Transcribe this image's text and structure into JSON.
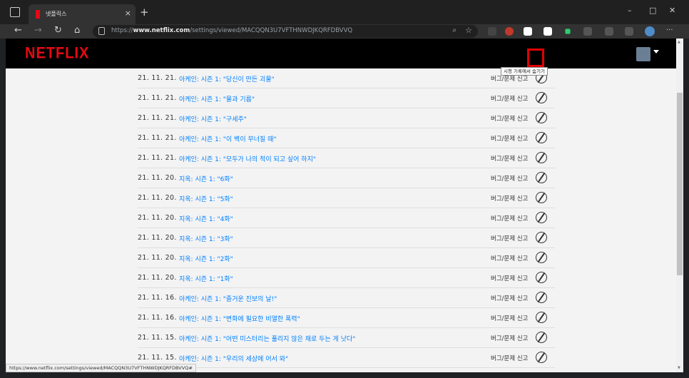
{
  "browser": {
    "tab_title": "넷플릭스",
    "tab_close": "×",
    "new_tab": "+",
    "window_controls": {
      "minimize": "–",
      "maximize": "□",
      "close": "✕"
    },
    "nav": {
      "back": "←",
      "forward": "→",
      "refresh": "↻",
      "home": "⌂"
    },
    "url_prefix": "https://",
    "url_host": "www.netflix.com",
    "url_path": "/settings/viewed/MACQQN3U7VFTHNWDJKQRFDBVVQ",
    "menu": "···"
  },
  "page": {
    "logo": "NETFLIX",
    "rows": [
      {
        "date": "21. 11. 21.",
        "title": "아케인: 시즌 1: \"당신이 만든 괴물\"",
        "report": "버그/문제 신고"
      },
      {
        "date": "21. 11. 21.",
        "title": "아케인: 시즌 1: \"물과 기름\"",
        "report": "버그/문제 신고"
      },
      {
        "date": "21. 11. 21.",
        "title": "아케인: 시즌 1: \"구세주\"",
        "report": "버그/문제 신고"
      },
      {
        "date": "21. 11. 21.",
        "title": "아케인: 시즌 1: \"이 벽이 무너질 때\"",
        "report": "버그/문제 신고"
      },
      {
        "date": "21. 11. 21.",
        "title": "아케인: 시즌 1: \"모두가 나의 적이 되고 싶어 하지\"",
        "report": "버그/문제 신고"
      },
      {
        "date": "21. 11. 20.",
        "title": "지옥: 시즌 1: \"6화\"",
        "report": "버그/문제 신고"
      },
      {
        "date": "21. 11. 20.",
        "title": "지옥: 시즌 1: \"5화\"",
        "report": "버그/문제 신고"
      },
      {
        "date": "21. 11. 20.",
        "title": "지옥: 시즌 1: \"4화\"",
        "report": "버그/문제 신고"
      },
      {
        "date": "21. 11. 20.",
        "title": "지옥: 시즌 1: \"3화\"",
        "report": "버그/문제 신고"
      },
      {
        "date": "21. 11. 20.",
        "title": "지옥: 시즌 1: \"2화\"",
        "report": "버그/문제 신고"
      },
      {
        "date": "21. 11. 20.",
        "title": "지옥: 시즌 1: \"1화\"",
        "report": "버그/문제 신고"
      },
      {
        "date": "21. 11. 16.",
        "title": "아케인: 시즌 1: \"즐거운 진보의 날!\"",
        "report": "버그/문제 신고"
      },
      {
        "date": "21. 11. 16.",
        "title": "아케인: 시즌 1: \"변화에 필요한 비열한 폭력\"",
        "report": "버그/문제 신고"
      },
      {
        "date": "21. 11. 15.",
        "title": "아케인: 시즌 1: \"어떤 미스터리는 풀리지 않은 채로 두는 게 낫다\"",
        "report": "버그/문제 신고"
      },
      {
        "date": "21. 11. 15.",
        "title": "아케인: 시즌 1: \"우리의 세상에 어서 와\"",
        "report": "버그/문제 신고"
      }
    ],
    "tooltip": "시청 기록에서 숨기기",
    "status_url": "https://www.netflix.com/settings/viewed/MACQQN3U7VFTHNWDJKQRFDBVVQ#"
  }
}
